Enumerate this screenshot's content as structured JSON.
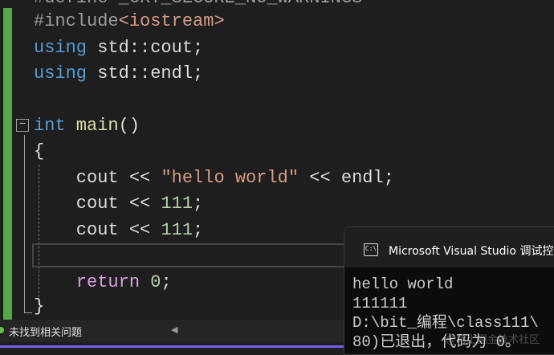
{
  "code": {
    "line0": "#define _CRT_SECURE_NO_WARNINGS",
    "include_kw": "#include",
    "include_hdr": "<iostream>",
    "using": "using",
    "cout_decl": " std::cout;",
    "endl_decl": " std::endl;",
    "int": "int",
    "main": " main",
    "parens": "()",
    "open_brace": "{",
    "cout1_a": "    cout << ",
    "cout1_str": "\"hello world\"",
    "cout1_b": " << endl;",
    "cout2_a": "    cout << ",
    "cout2_num": "111",
    "semi": ";",
    "cout3_a": "    cout << ",
    "cout3_num": "111",
    "return_kw": "    return",
    "return_num": " 0",
    "close_brace": "}",
    "fold_symbol": "−"
  },
  "status": {
    "message": "未找到相关问题"
  },
  "console": {
    "icon_text": "C:\\",
    "title": "Microsoft Visual Studio 调试控制台",
    "output": [
      "hello world",
      "111111",
      "D:\\bit_编程\\class111\\",
      "80)已退出，代码为 0。"
    ]
  },
  "watermark": "@稀土掘金技术社区"
}
